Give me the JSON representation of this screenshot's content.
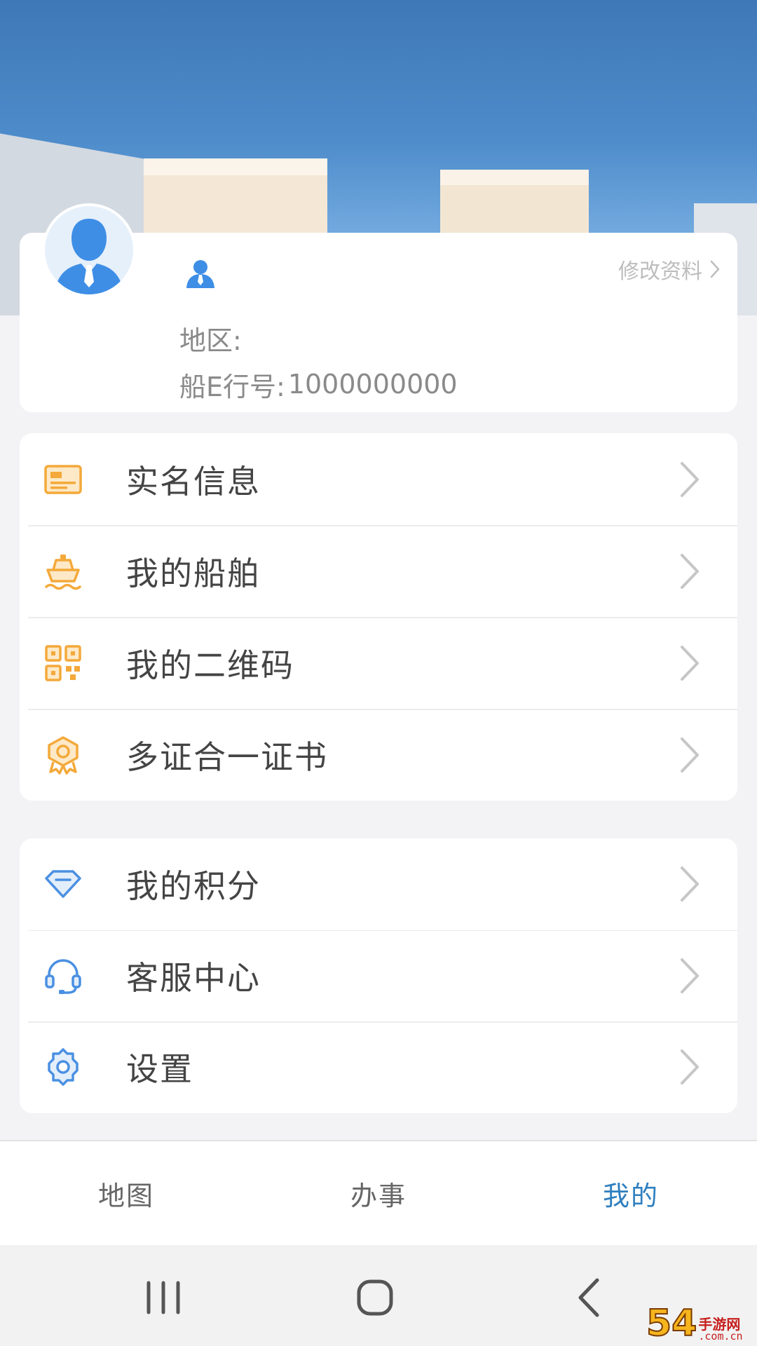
{
  "profile": {
    "edit_label": "修改资料",
    "region_label": "地区:",
    "region_value": "",
    "account_label": "船E行号:",
    "account_value": "1000000000"
  },
  "menu_group_1": [
    {
      "label": "实名信息",
      "icon": "id-card-icon"
    },
    {
      "label": "我的船舶",
      "icon": "ship-icon"
    },
    {
      "label": "我的二维码",
      "icon": "qr-code-icon"
    },
    {
      "label": "多证合一证书",
      "icon": "certificate-badge-icon"
    }
  ],
  "menu_group_2": [
    {
      "label": "我的积分",
      "icon": "diamond-icon"
    },
    {
      "label": "客服中心",
      "icon": "headset-icon"
    },
    {
      "label": "设置",
      "icon": "gear-icon"
    }
  ],
  "tabs": [
    {
      "label": "地图",
      "active": false
    },
    {
      "label": "办事",
      "active": false
    },
    {
      "label": "我的",
      "active": true
    }
  ],
  "watermark": {
    "big": "54",
    "line1": "手游网",
    "line2": ".com.cn"
  },
  "colors": {
    "accent_orange": "#f4a93a",
    "accent_blue": "#4a90e2",
    "active_tab": "#2f7fbf",
    "text_gray": "#8a8a8a"
  }
}
